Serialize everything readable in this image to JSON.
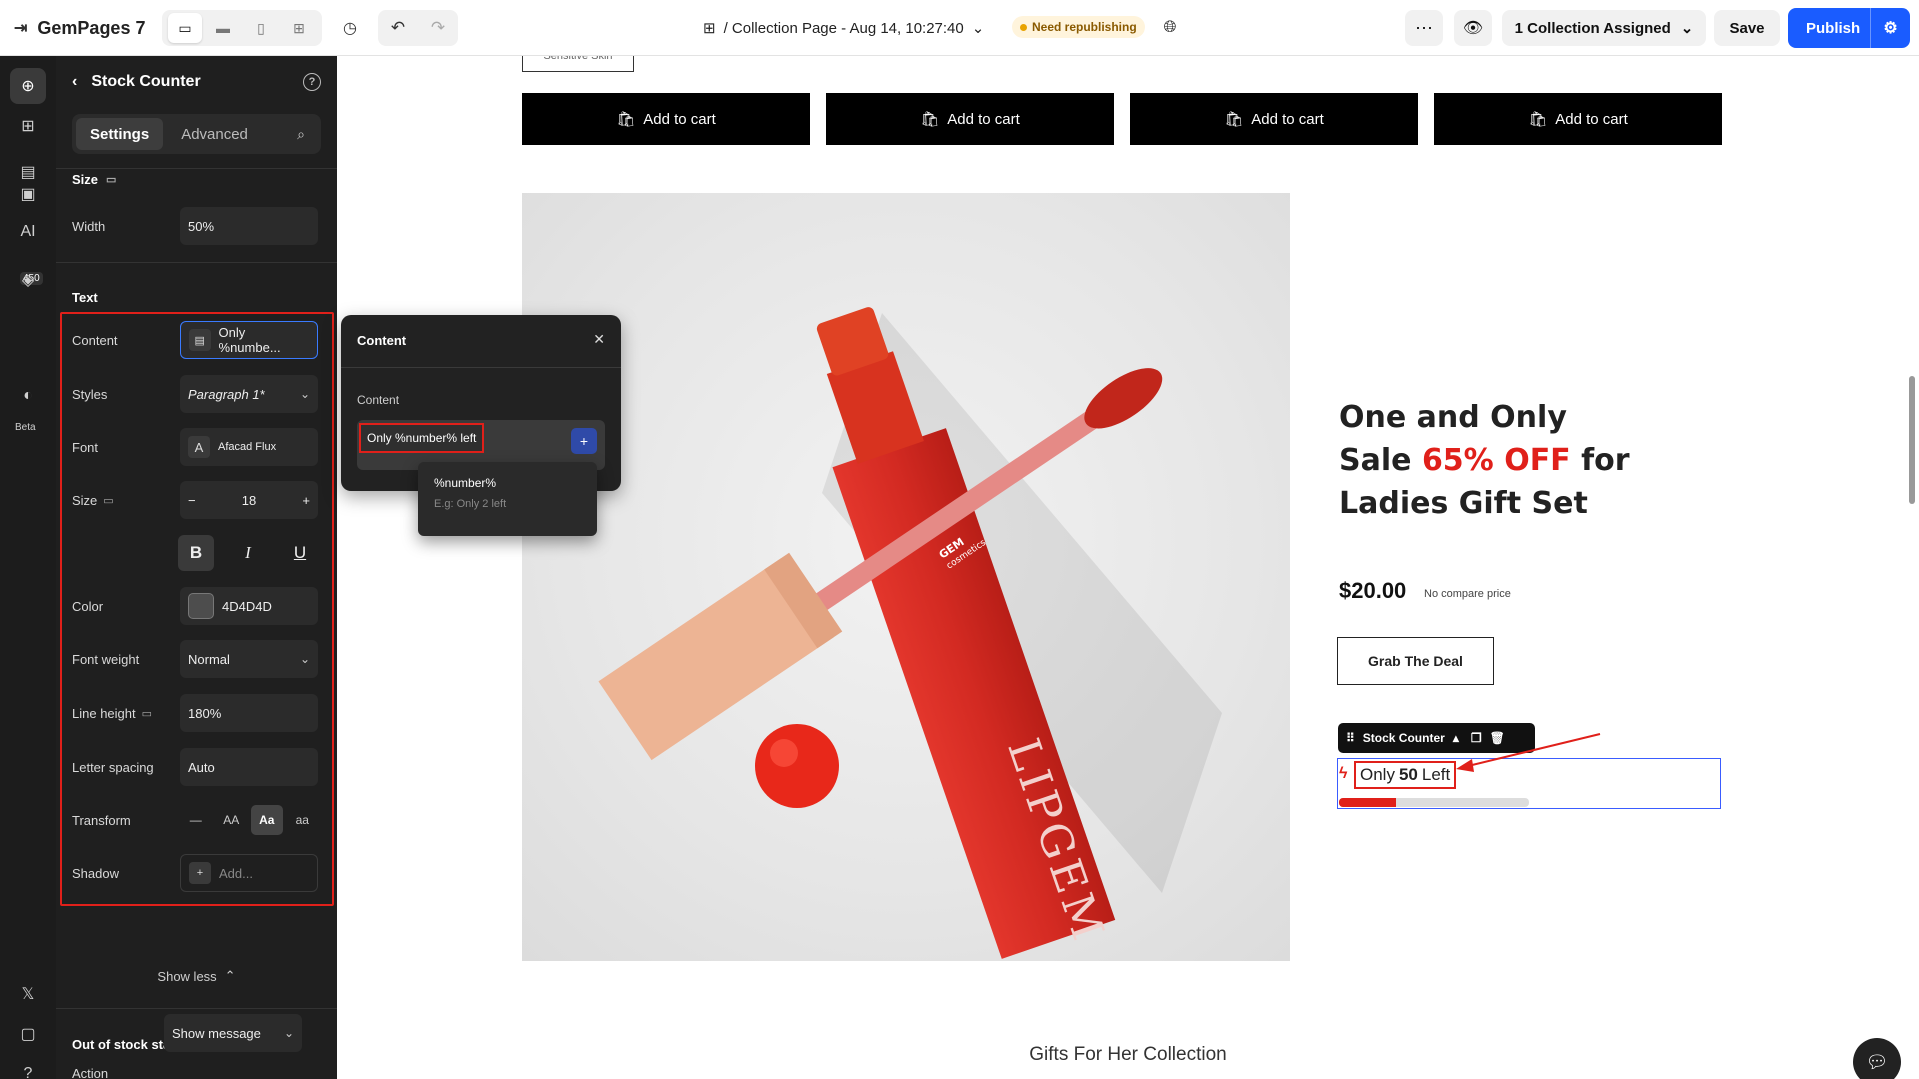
{
  "topbar": {
    "brand": "GemPages 7",
    "page_name": "/ Collection Page - Aug 14, 10:27:40",
    "status_badge": "Need republishing",
    "assign_label": "1 Collection Assigned",
    "save_label": "Save",
    "publish_label": "Publish"
  },
  "rail": {
    "badge": "450",
    "beta": "Beta"
  },
  "panel": {
    "title": "Stock Counter",
    "tabs": [
      "Settings",
      "Advanced"
    ],
    "size_section": "Size",
    "width_label": "Width",
    "width_value": "50%",
    "text_section": "Text",
    "content_label": "Content",
    "content_value": "Only %numbe...",
    "styles_label": "Styles",
    "styles_value": "Paragraph 1*",
    "font_label": "Font",
    "font_value": "Afacad Flux",
    "size_label": "Size",
    "size_value": "18",
    "color_label": "Color",
    "color_value": "4D4D4D",
    "weight_label": "Font weight",
    "weight_value": "Normal",
    "lineheight_label": "Line height",
    "lineheight_value": "180%",
    "letterspacing_label": "Letter spacing",
    "letterspacing_value": "Auto",
    "transform_label": "Transform",
    "transform_options": [
      "—",
      "AA",
      "Aa",
      "aa"
    ],
    "shadow_label": "Shadow",
    "shadow_placeholder": "Add...",
    "show_less": "Show less",
    "oos_section": "Out of stock state",
    "action_label": "Action",
    "action_value": "Show message"
  },
  "popover": {
    "title": "Content",
    "field_label": "Content",
    "field_value": "Only %number% left",
    "suggest_token": "%number%",
    "suggest_hint": "E.g: Only 2 left"
  },
  "canvas": {
    "sensitive_tag": "Sensitive Skin",
    "add_to_cart": "Add to cart",
    "headline_line1": "One and Only",
    "headline_sale": "Sale ",
    "headline_off": "65% OFF",
    "headline_for": " for",
    "headline_line3": "Ladies Gift Set",
    "price": "$20.00",
    "compare_price": "No compare price",
    "grab_label": "Grab The Deal",
    "stock_toolbar_label": "Stock Counter",
    "stock_text_pre": "Only",
    "stock_number": "50",
    "stock_text_post": "Left",
    "stock_fill_fraction": 0.3,
    "product_brand_lipgem": "LIPGEM",
    "product_brand_gem": "GEM",
    "product_brand_cosmetics": "cosmetics",
    "collection_title": "Gifts For Her Collection"
  },
  "colors": {
    "accent_blue": "#1a5cff",
    "highlight_red": "#e0201a",
    "text_color_swatch": "#4D4D4D"
  }
}
